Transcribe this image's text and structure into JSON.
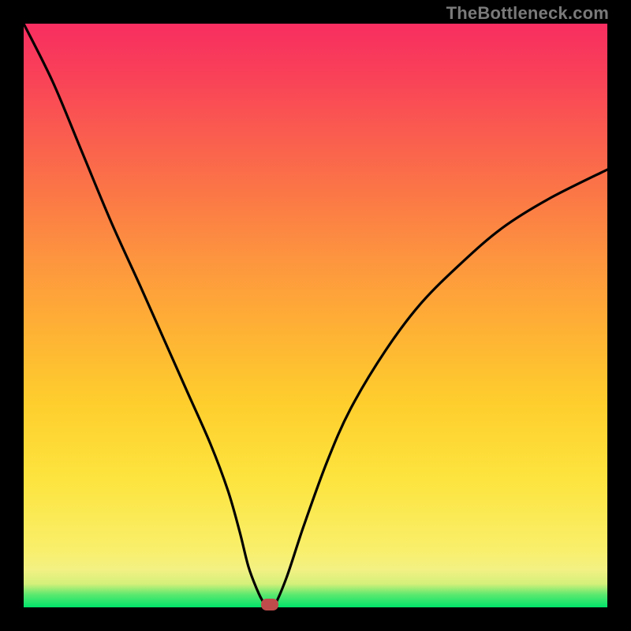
{
  "watermark": {
    "text": "TheBottleneck.com"
  },
  "colors": {
    "frame": "#000000",
    "curve_stroke": "#000000",
    "marker": "#c04b4b",
    "watermark": "#7a7a7a"
  },
  "chart_data": {
    "type": "line",
    "title": "",
    "xlabel": "",
    "ylabel": "",
    "xlim": [
      0,
      100
    ],
    "ylim": [
      0,
      100
    ],
    "grid": false,
    "series": [
      {
        "name": "bottleneck-curve",
        "x": [
          0,
          5,
          10,
          15,
          20,
          24,
          28,
          32,
          35,
          37,
          38.5,
          40,
          41,
          42,
          42.8,
          45,
          48,
          52,
          56,
          62,
          68,
          75,
          82,
          90,
          100
        ],
        "values": [
          100,
          90,
          78,
          66,
          55,
          46,
          37,
          28,
          20,
          13,
          7,
          3,
          1,
          0,
          0,
          5,
          14,
          25,
          34,
          44,
          52,
          59,
          65,
          70,
          75
        ]
      }
    ],
    "marker": {
      "x": 42.2,
      "y": 0
    },
    "gradient_stops": [
      {
        "pos": 0.0,
        "color": "#00e46a"
      },
      {
        "pos": 0.022,
        "color": "#5de86f"
      },
      {
        "pos": 0.04,
        "color": "#d4f07a"
      },
      {
        "pos": 0.065,
        "color": "#f3f183"
      },
      {
        "pos": 0.1,
        "color": "#f9ef6a"
      },
      {
        "pos": 0.22,
        "color": "#fde43e"
      },
      {
        "pos": 0.35,
        "color": "#fece2d"
      },
      {
        "pos": 0.48,
        "color": "#feb035"
      },
      {
        "pos": 0.6,
        "color": "#fd943f"
      },
      {
        "pos": 0.72,
        "color": "#fb7447"
      },
      {
        "pos": 0.82,
        "color": "#fa5a50"
      },
      {
        "pos": 0.91,
        "color": "#f94158"
      },
      {
        "pos": 1.0,
        "color": "#f82e60"
      }
    ]
  }
}
